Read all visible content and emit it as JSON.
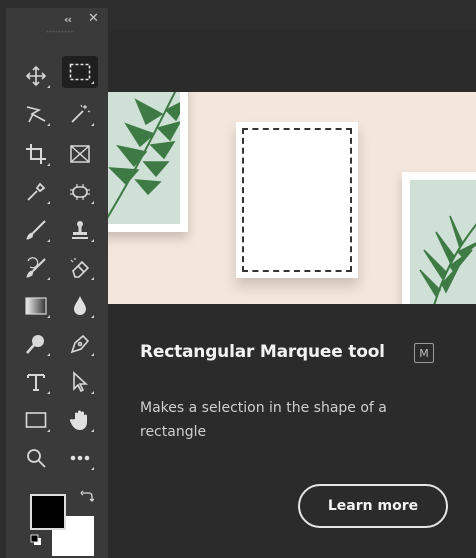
{
  "toolbar": {
    "collapse_glyph": "‹‹",
    "close_glyph": "✕",
    "tools": [
      {
        "name": "move-tool",
        "icon": "move-icon"
      },
      {
        "name": "rectangular-marquee-tool",
        "icon": "rectangular-marquee-icon",
        "selected": true
      },
      {
        "name": "lasso-tool",
        "icon": "lasso-icon"
      },
      {
        "name": "magic-wand-tool",
        "icon": "magic-wand-icon"
      },
      {
        "name": "crop-tool",
        "icon": "crop-icon"
      },
      {
        "name": "frame-tool",
        "icon": "frame-icon"
      },
      {
        "name": "eyedropper-tool",
        "icon": "eyedropper-icon"
      },
      {
        "name": "spot-healing-tool",
        "icon": "bandage-icon"
      },
      {
        "name": "brush-tool",
        "icon": "brush-icon"
      },
      {
        "name": "clone-stamp-tool",
        "icon": "stamp-icon"
      },
      {
        "name": "history-brush-tool",
        "icon": "history-brush-icon"
      },
      {
        "name": "eraser-tool",
        "icon": "eraser-icon"
      },
      {
        "name": "gradient-tool",
        "icon": "gradient-icon"
      },
      {
        "name": "blur-tool",
        "icon": "drop-icon"
      },
      {
        "name": "dodge-tool",
        "icon": "dodge-icon"
      },
      {
        "name": "pen-tool",
        "icon": "pen-icon"
      },
      {
        "name": "type-tool",
        "icon": "type-icon"
      },
      {
        "name": "path-selection-tool",
        "icon": "arrow-cursor-icon"
      },
      {
        "name": "rectangle-tool",
        "icon": "rectangle-icon"
      },
      {
        "name": "hand-tool",
        "icon": "hand-icon"
      },
      {
        "name": "zoom-tool",
        "icon": "zoom-icon"
      },
      {
        "name": "edit-toolbar",
        "icon": "more-icon"
      }
    ],
    "foreground_color": "#000000",
    "background_color": "#ffffff"
  },
  "tooltip": {
    "title": "Rectangular Marquee tool",
    "shortcut": "M",
    "description": "Makes a selection in the shape of a rectangle",
    "learn_more_label": "Learn more"
  },
  "colors": {
    "panel_bg": "#2b2b2b",
    "toolbar_bg": "#3a3a3a",
    "hero_bg": "#f3e6dc"
  }
}
